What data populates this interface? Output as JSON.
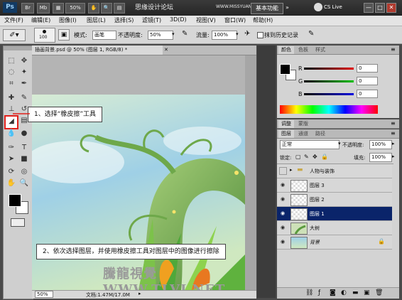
{
  "app": {
    "logo": "Ps",
    "bar_buttons": [
      "Br",
      "Mb"
    ],
    "zoom": "50%",
    "title": "思缘设计论坛",
    "watermark_top": "WWW.MISSYUAN.COM",
    "workspace": "基本功能",
    "cslive": "CS Live",
    "window_buttons": [
      "—",
      "□",
      "✕"
    ]
  },
  "menu": [
    "文件(F)",
    "编辑(E)",
    "图像(I)",
    "图层(L)",
    "选择(S)",
    "滤镜(T)",
    "3D(D)",
    "视图(V)",
    "窗口(W)",
    "帮助(H)"
  ],
  "options": {
    "brush_size": "100",
    "mode_label": "模式:",
    "mode_value": "画笔",
    "opacity_label": "不透明度:",
    "opacity_value": "50%",
    "flow_label": "流量:",
    "flow_value": "100%",
    "history_label": "抹到历史记录"
  },
  "document": {
    "tab_title": "插画背景.psd @ 50% (图层 1, RGB/8) *",
    "zoom": "50%",
    "doc_info": "文档:1.47M/17.0M"
  },
  "callouts": {
    "step1": "1、选择“橡皮擦”工具",
    "step2": "2、依次选择图层，并使用橡皮擦工具对图层中的图像进行擦除"
  },
  "watermark_bottom": "騰龍視覺 WWW.TLVI.NET",
  "color_panel": {
    "tabs": [
      "颜色",
      "色板",
      "样式"
    ],
    "channels": [
      {
        "label": "R",
        "value": "0",
        "color": "#e00000"
      },
      {
        "label": "G",
        "value": "0",
        "color": "#00a000"
      },
      {
        "label": "B",
        "value": "0",
        "color": "#0000e0"
      }
    ]
  },
  "adjust_panel": {
    "tabs": [
      "调整",
      "蒙版"
    ]
  },
  "layers_panel": {
    "tabs": [
      "图层",
      "通道",
      "路径"
    ],
    "blend_mode": "正常",
    "opacity_label": "不透明度:",
    "opacity_value": "100%",
    "lock_label": "锁定:",
    "fill_label": "填充:",
    "fill_value": "100%",
    "layers": [
      {
        "name": "人物与装饰",
        "type": "group",
        "visible": false,
        "selected": false
      },
      {
        "name": "图层 3",
        "type": "layer",
        "visible": true,
        "selected": false
      },
      {
        "name": "图层 2",
        "type": "layer",
        "visible": true,
        "selected": false
      },
      {
        "name": "图层 1",
        "type": "layer",
        "visible": true,
        "selected": true
      },
      {
        "name": "大树",
        "type": "layer",
        "visible": true,
        "selected": false
      },
      {
        "name": "背景",
        "type": "background",
        "visible": true,
        "selected": false
      }
    ]
  }
}
